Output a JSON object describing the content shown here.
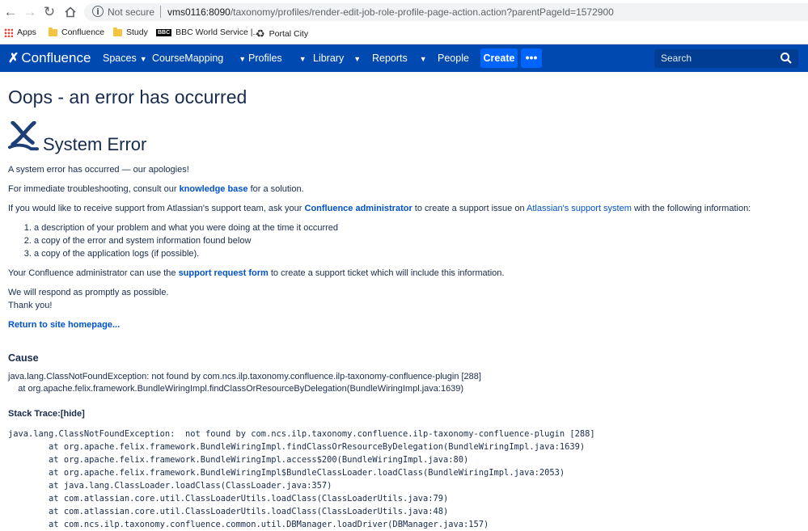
{
  "browser": {
    "not_secure": "Not secure",
    "url_host": "vms0116:8090",
    "url_path": "/taxonomy/profiles/render-edit-job-role-profile-page-action.action?parentPageId=1572900",
    "bookmarks": [
      {
        "label": "Apps",
        "icon": "apps-grid-icon"
      },
      {
        "label": "Confluence",
        "icon": "folder-icon"
      },
      {
        "label": "Study",
        "icon": "folder-icon"
      },
      {
        "label": "BBC World Service |...",
        "icon": "bbc-icon"
      },
      {
        "label": "Portal City",
        "icon": "portal-icon"
      }
    ],
    "bbc_badge": "BBC"
  },
  "header": {
    "logo": "Confluence",
    "nav": [
      "Spaces",
      "CourseMapping",
      "Profiles",
      "Library",
      "Reports",
      "People"
    ],
    "create": "Create",
    "more": "•••",
    "search_placeholder": "Search",
    "colors": {
      "bar": "#0049b0",
      "button": "#0065ff"
    }
  },
  "page": {
    "title": "Oops - an error has occurred",
    "system_error": "System Error",
    "apology": "A system error has occurred — our apologies!",
    "troubleshoot_pre": "For immediate troubleshooting, consult our ",
    "troubleshoot_link": "knowledge base",
    "troubleshoot_post": " for a solution.",
    "support_pre": "If you would like to receive support from Atlassian's support team, ask your ",
    "support_link_admin": "Confluence administrator",
    "support_mid": " to create a support issue on ",
    "support_link_system": "Atlassian's support system",
    "support_post": " with the following information:",
    "info_items": [
      "a description of your problem and what you were doing at the time it occurred",
      "a copy of the error and system information found below",
      "a copy of the application logs (if possible)."
    ],
    "admin_pre": "Your Confluence administrator can use the ",
    "admin_link": "support request form",
    "admin_post": " to create a support ticket which will include this information.",
    "respond": "We will respond as promptly as possible.",
    "thanks": "Thank you!",
    "home_link": "Return to site homepage...",
    "cause_heading": "Cause",
    "cause_line1": "java.lang.ClassNotFoundException: not found by com.ncs.ilp.taxonomy.confluence.ilp-taxonomy-confluence-plugin [288]",
    "cause_line2": "    at org.apache.felix.framework.BundleWiringImpl.findClassOrResourceByDelegation(BundleWiringImpl.java:1639)",
    "stack_label": "Stack Trace:",
    "stack_toggle": "[hide]",
    "stack_trace": [
      "java.lang.ClassNotFoundException:  not found by com.ncs.ilp.taxonomy.confluence.ilp-taxonomy-confluence-plugin [288]",
      "\tat org.apache.felix.framework.BundleWiringImpl.findClassOrResourceByDelegation(BundleWiringImpl.java:1639)",
      "\tat org.apache.felix.framework.BundleWiringImpl.access$200(BundleWiringImpl.java:80)",
      "\tat org.apache.felix.framework.BundleWiringImpl$BundleClassLoader.loadClass(BundleWiringImpl.java:2053)",
      "\tat java.lang.ClassLoader.loadClass(ClassLoader.java:357)",
      "\tat com.atlassian.core.util.ClassLoaderUtils.loadClass(ClassLoaderUtils.java:79)",
      "\tat com.atlassian.core.util.ClassLoaderUtils.loadClass(ClassLoaderUtils.java:48)",
      "\tat com.ncs.ilp.taxonomy.confluence.common.util.DBManager.loadDriver(DBManager.java:157)"
    ]
  }
}
